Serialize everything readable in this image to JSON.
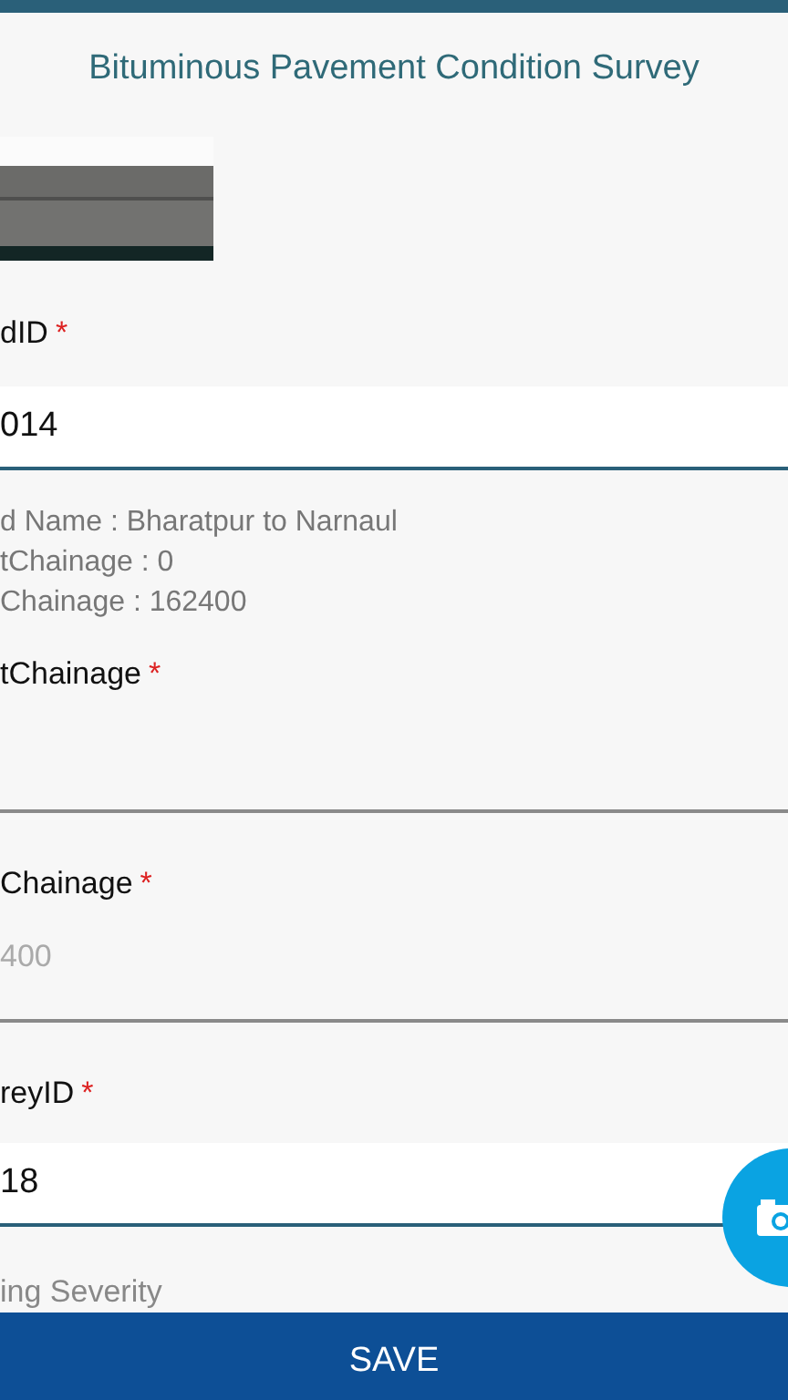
{
  "title": "Bituminous Pavement Condition Survey",
  "fields": [
    {
      "kind": "label",
      "text": "dID",
      "marker": "*"
    },
    {
      "kind": "select",
      "value": "014"
    },
    {
      "kind": "info",
      "lines": [
        "d Name : Bharatpur to Narnaul",
        "tChainage : 0",
        "Chainage : 162400"
      ]
    },
    {
      "kind": "label",
      "text": "tChainage",
      "marker": "*"
    },
    {
      "kind": "input"
    },
    {
      "kind": "label",
      "text": "Chainage",
      "marker": "*"
    },
    {
      "kind": "input",
      "placeholder": "400"
    },
    {
      "kind": "label",
      "text": "reyID",
      "marker": "*"
    },
    {
      "kind": "select",
      "value": "18"
    },
    {
      "kind": "hint",
      "text": "ing Severity"
    }
  ],
  "save_button": "SAVE"
}
